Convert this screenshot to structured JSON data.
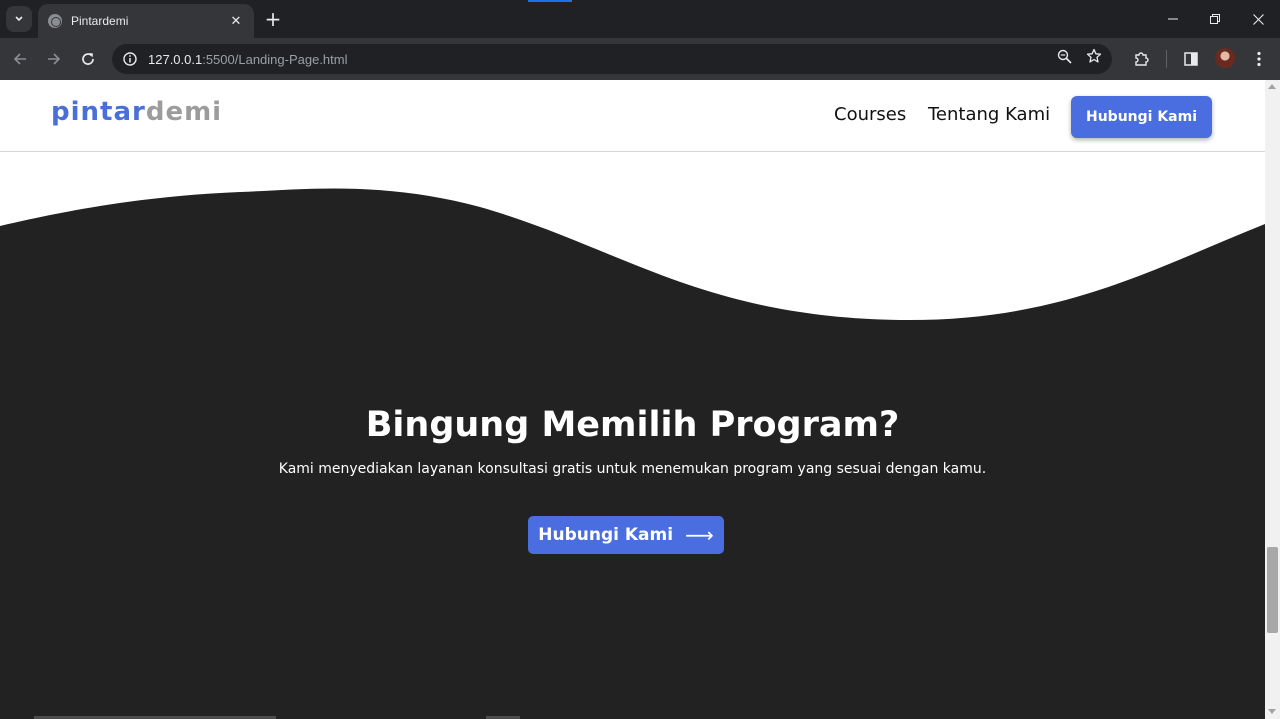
{
  "browser": {
    "tab_title": "Pintardemi",
    "tab_close": "✕",
    "new_tab": "+",
    "url_host": "127.0.0.1",
    "url_rest": ":5500/Landing-Page.html"
  },
  "navbar": {
    "logo_part1": "pintar",
    "logo_part2": "demi",
    "links": [
      {
        "label": "Courses"
      },
      {
        "label": "Tentang Kami"
      }
    ],
    "cta_label": "Hubungi Kami"
  },
  "hero": {
    "title": "Bingung Memilih Program?",
    "subtitle": "Kami menyediakan layanan konsultasi gratis untuk menemukan program yang sesuai dengan kamu.",
    "cta_label": "Hubungi Kami",
    "cta_arrow": "⟶"
  },
  "colors": {
    "accent": "#4a6ee0",
    "dark_bg": "#222222",
    "logo_blue": "#4a6fd8",
    "logo_gray": "#9c9c9c"
  },
  "icons": [
    "tab-search-icon",
    "globe-icon",
    "close-icon",
    "plus-icon",
    "minimize-icon",
    "restore-icon",
    "window-close-icon",
    "back-icon",
    "forward-icon",
    "reload-icon",
    "site-info-icon",
    "zoom-icon",
    "star-icon",
    "extensions-icon",
    "side-panel-icon",
    "menu-icon",
    "arrow-right-icon"
  ]
}
